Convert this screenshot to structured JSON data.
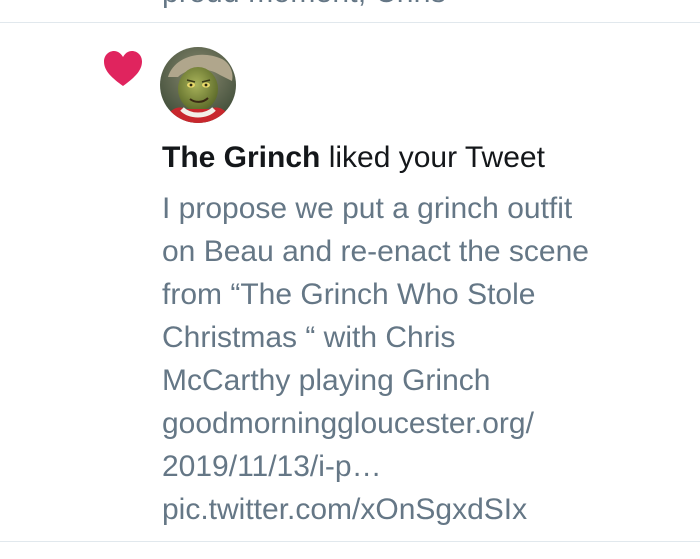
{
  "previous_item": {
    "partial_text": "proud moment, Chris"
  },
  "notification": {
    "icon": "heart-icon",
    "icon_color": "#e0245e",
    "actor_name": "The Grinch",
    "action_text": " liked your Tweet",
    "tweet_lines": [
      "I propose we put a grinch outfit",
      "on Beau and re-enact the scene",
      "from “The Grinch Who Stole",
      "Christmas “ with Chris",
      "McCarthy playing Grinch",
      "goodmorninggloucester.org/",
      "2019/11/13/i-p…",
      "pic.twitter.com/xOnSgxdSIx"
    ]
  },
  "colors": {
    "primary_text": "#14171a",
    "secondary_text": "#657786",
    "divider": "#e1e8ed",
    "like_red": "#e0245e"
  }
}
